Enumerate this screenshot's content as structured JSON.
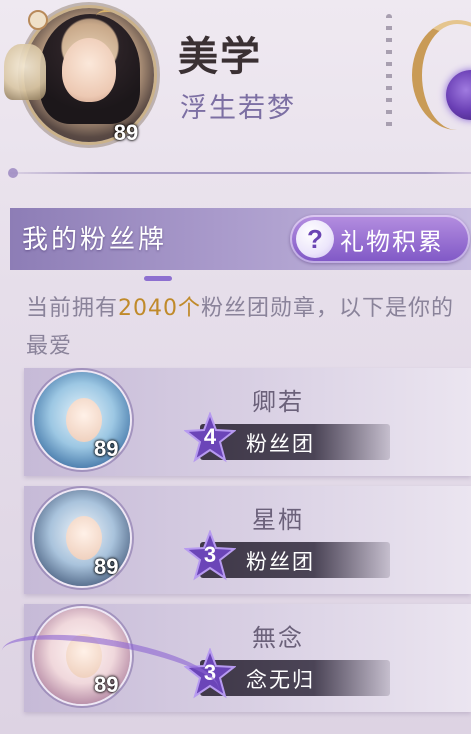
{
  "profile": {
    "name": "美学",
    "subtitle": "浮生若梦",
    "level": "89"
  },
  "section": {
    "title": "我的粉丝牌",
    "gift_button_label": "礼物积累",
    "gift_button_icon": "?"
  },
  "description": {
    "prefix": "当前拥有",
    "count": "2040个",
    "suffix": "粉丝团勋章，以下是你的最爱"
  },
  "fans": [
    {
      "name": "卿若",
      "level": "89",
      "tag_level": "4",
      "tag_text": "粉丝团"
    },
    {
      "name": "星栖",
      "level": "89",
      "tag_level": "3",
      "tag_text": "粉丝团"
    },
    {
      "name": "無念",
      "level": "89",
      "tag_level": "3",
      "tag_text": "念无归"
    }
  ],
  "colors": {
    "accent": "#8d7db6",
    "highlight": "#c08a2a",
    "subtitle": "#7c6fa3"
  }
}
